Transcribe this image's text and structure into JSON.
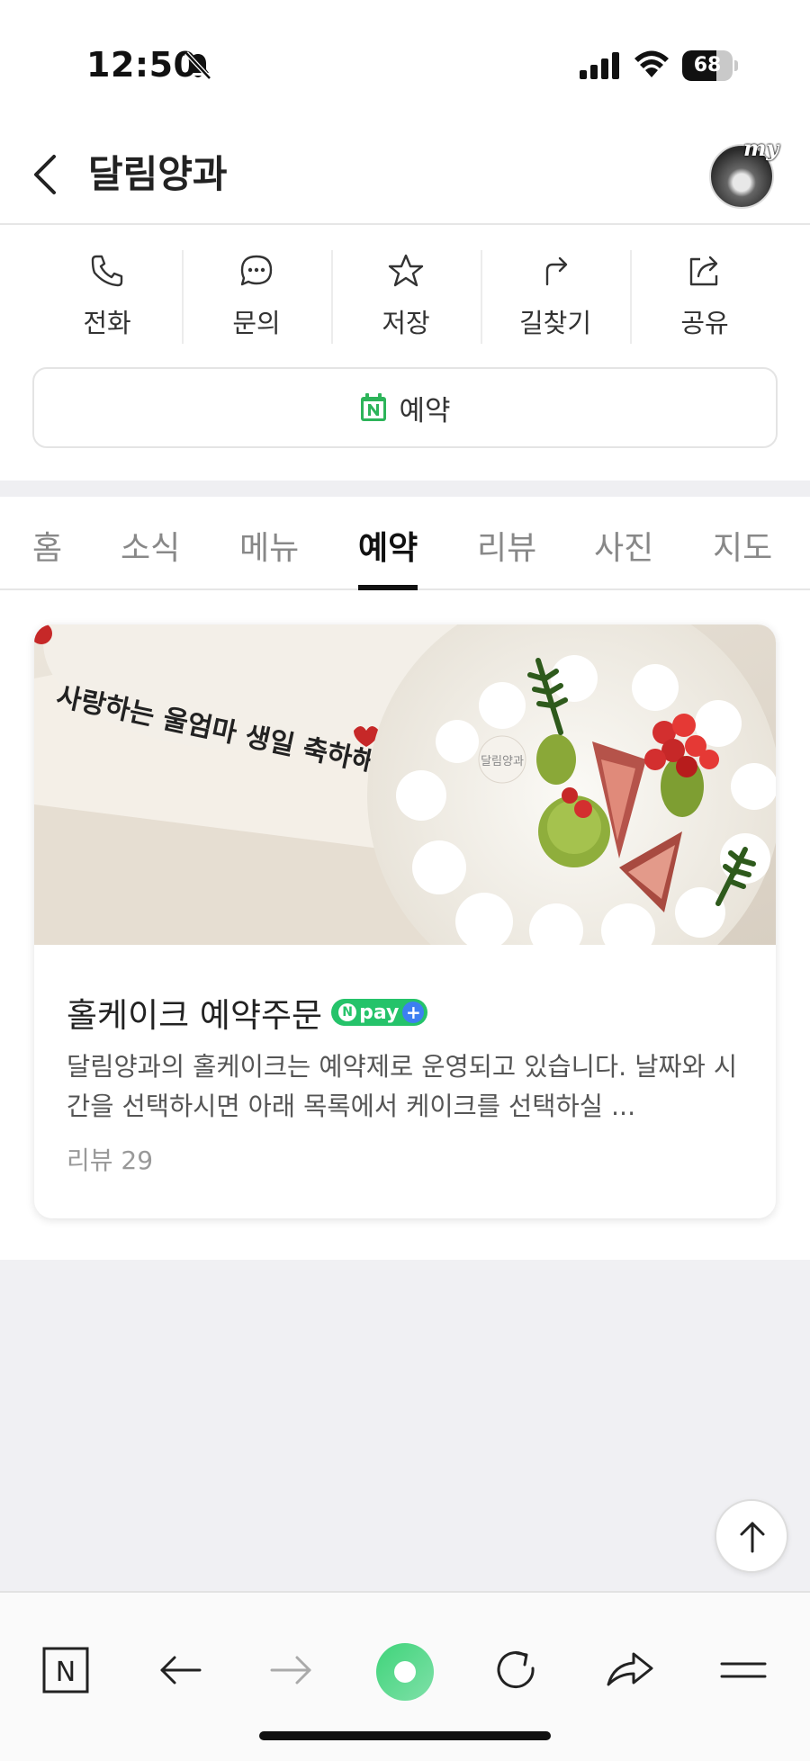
{
  "status_bar": {
    "time": "12:50",
    "battery": "68",
    "battery_level": 0.68
  },
  "header": {
    "title": "달림양과",
    "avatar_badge": "my"
  },
  "actions": [
    {
      "label": "전화",
      "icon": "phone-icon"
    },
    {
      "label": "문의",
      "icon": "chat-icon"
    },
    {
      "label": "저장",
      "icon": "star-icon"
    },
    {
      "label": "길찾기",
      "icon": "directions-icon"
    },
    {
      "label": "공유",
      "icon": "share-icon"
    }
  ],
  "reserve_button": {
    "label": "예약",
    "icon": "naver-calendar-icon"
  },
  "tabs": [
    {
      "label": "홈",
      "active": false
    },
    {
      "label": "소식",
      "active": false
    },
    {
      "label": "메뉴",
      "active": false
    },
    {
      "label": "예약",
      "active": true
    },
    {
      "label": "리뷰",
      "active": false
    },
    {
      "label": "사진",
      "active": false
    },
    {
      "label": "지도",
      "active": false
    }
  ],
  "card": {
    "image_text": "사랑하는 울엄마 생일 축하해요",
    "image_logo": "달림양과",
    "title": "홀케이크 예약주문",
    "badge": {
      "n": "N",
      "text": "pay",
      "plus": "+"
    },
    "description": "달림양과의 홀케이크는 예약제로 운영되고 있습니다. 날짜와 시간을 선택하시면 아래 목록에서 케이크를 선택하실 ...",
    "review": "리뷰 29"
  },
  "browser_bar": {
    "buttons": [
      "naver-home-icon",
      "back-arrow-icon",
      "forward-arrow-icon",
      "green-dot-icon",
      "reload-icon",
      "share-arrow-icon",
      "menu-icon"
    ],
    "home_letter": "N"
  },
  "colors": {
    "accent_green": "#25c36a",
    "pay_blue": "#3d7ff1",
    "tab_active": "#111111",
    "gray_bg": "#f0f0f3"
  }
}
